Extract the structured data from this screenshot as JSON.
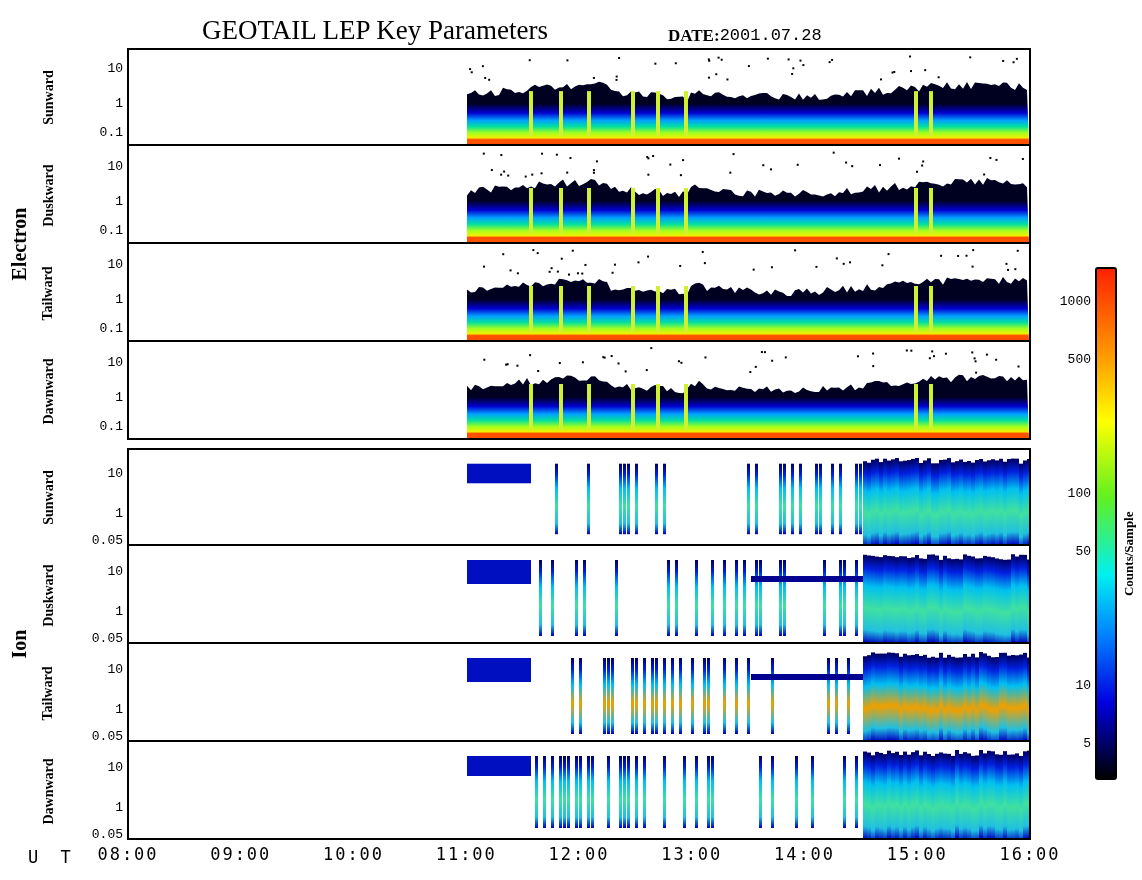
{
  "title": "GEOTAIL LEP Key Parameters",
  "date": {
    "label": "DATE:",
    "value": "2001.07.28"
  },
  "groups": [
    {
      "name": "Electron",
      "kind": "electron",
      "panels": [
        {
          "label": "Sunward",
          "ticks": [
            "10",
            "1",
            "0.1"
          ]
        },
        {
          "label": "Duskward",
          "ticks": [
            "10",
            "1",
            "0.1"
          ]
        },
        {
          "label": "Tailward",
          "ticks": [
            "10",
            "1",
            "0.1"
          ]
        },
        {
          "label": "Dawnward",
          "ticks": [
            "10",
            "1",
            "0.1"
          ]
        }
      ]
    },
    {
      "name": "Ion",
      "kind": "ion",
      "panels": [
        {
          "label": "Sunward",
          "ticks": [
            "10",
            "1",
            "0.05"
          ]
        },
        {
          "label": "Duskward",
          "ticks": [
            "10",
            "1",
            "0.05"
          ]
        },
        {
          "label": "Tailward",
          "ticks": [
            "10",
            "1",
            "0.05"
          ]
        },
        {
          "label": "Dawnward",
          "ticks": [
            "10",
            "1",
            "0.05"
          ]
        }
      ]
    }
  ],
  "colorbar": {
    "title": "Counts/Sample",
    "ticks": [
      "1000",
      "500",
      "100",
      "50",
      "10",
      "5"
    ]
  },
  "time_axis": {
    "label": "U T",
    "ticks": [
      "08:00",
      "09:00",
      "10:00",
      "11:00",
      "12:00",
      "13:00",
      "14:00",
      "15:00",
      "16:00"
    ]
  }
}
